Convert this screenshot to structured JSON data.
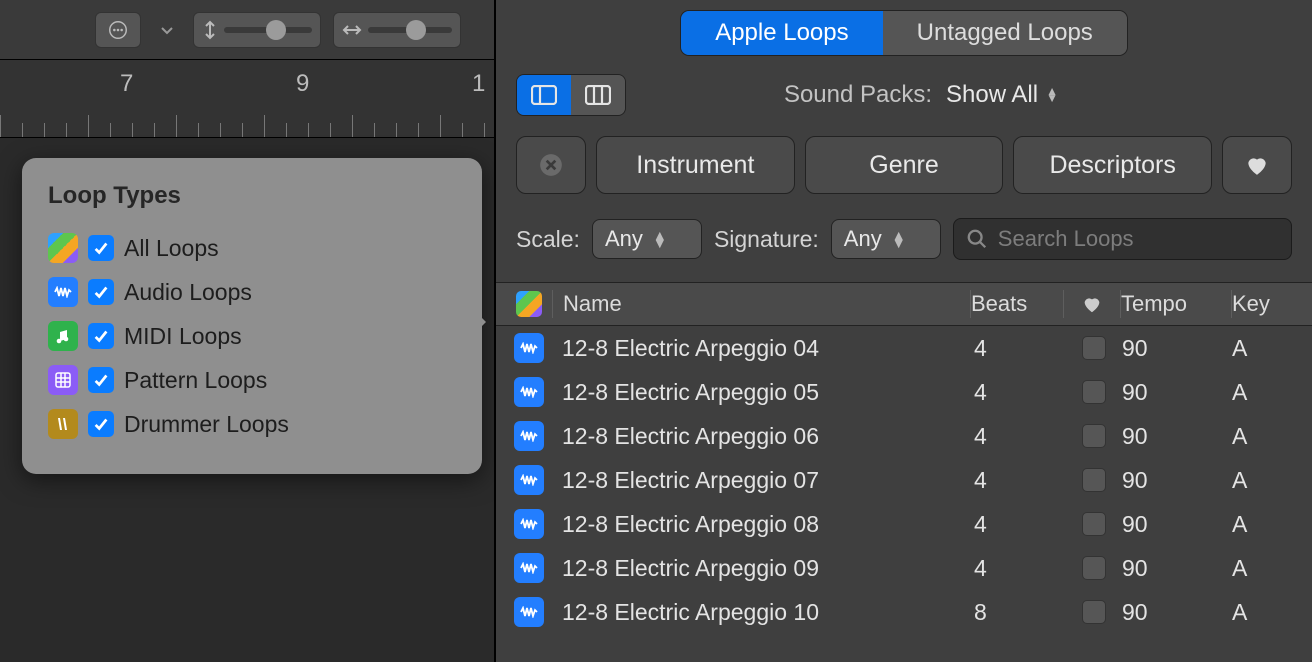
{
  "timeline": {
    "markers": [
      "7",
      "9"
    ]
  },
  "popover": {
    "title": "Loop Types",
    "items": [
      {
        "label": "All Loops",
        "icon": "all"
      },
      {
        "label": "Audio Loops",
        "icon": "audio"
      },
      {
        "label": "MIDI Loops",
        "icon": "midi"
      },
      {
        "label": "Pattern Loops",
        "icon": "pattern"
      },
      {
        "label": "Drummer Loops",
        "icon": "drummer"
      }
    ]
  },
  "tabs": {
    "apple": "Apple Loops",
    "untagged": "Untagged Loops"
  },
  "sound_packs": {
    "label": "Sound Packs:",
    "value": "Show All"
  },
  "filters": {
    "instrument": "Instrument",
    "genre": "Genre",
    "descriptors": "Descriptors"
  },
  "scale": {
    "label": "Scale:",
    "value": "Any"
  },
  "signature": {
    "label": "Signature:",
    "value": "Any"
  },
  "search": {
    "placeholder": "Search Loops"
  },
  "columns": {
    "name": "Name",
    "beats": "Beats",
    "tempo": "Tempo",
    "key": "Key"
  },
  "rows": [
    {
      "name": "12-8 Electric Arpeggio 04",
      "beats": "4",
      "tempo": "90",
      "key": "A"
    },
    {
      "name": "12-8 Electric Arpeggio 05",
      "beats": "4",
      "tempo": "90",
      "key": "A"
    },
    {
      "name": "12-8 Electric Arpeggio 06",
      "beats": "4",
      "tempo": "90",
      "key": "A"
    },
    {
      "name": "12-8 Electric Arpeggio 07",
      "beats": "4",
      "tempo": "90",
      "key": "A"
    },
    {
      "name": "12-8 Electric Arpeggio 08",
      "beats": "4",
      "tempo": "90",
      "key": "A"
    },
    {
      "name": "12-8 Electric Arpeggio 09",
      "beats": "4",
      "tempo": "90",
      "key": "A"
    },
    {
      "name": "12-8 Electric Arpeggio 10",
      "beats": "8",
      "tempo": "90",
      "key": "A"
    }
  ]
}
